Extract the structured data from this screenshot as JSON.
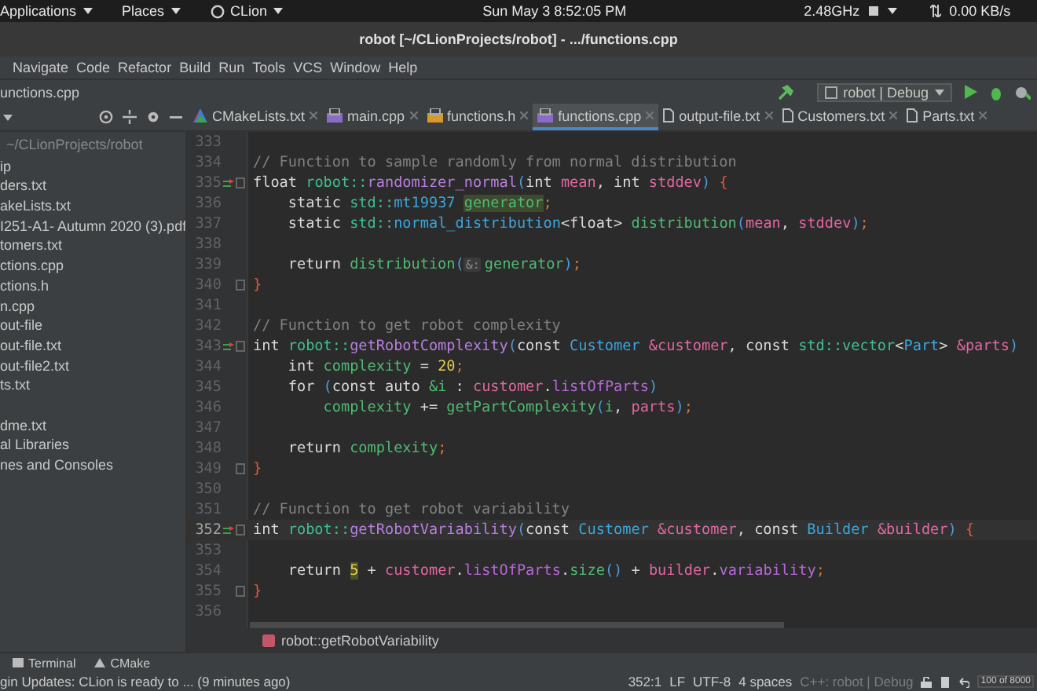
{
  "top_panel": {
    "menus": [
      "Applications",
      "Places",
      "CLion"
    ],
    "clock": "Sun May 3  8:52:05 PM",
    "cpu": "2.48GHz",
    "network": "0.00 KB/s"
  },
  "window": {
    "title": "robot [~/CLionProjects/robot] - .../functions.cpp"
  },
  "menu_bar": [
    "Navigate",
    "Code",
    "Refactor",
    "Build",
    "Run",
    "Tools",
    "VCS",
    "Window",
    "Help"
  ],
  "nav_bar": {
    "path": "unctions.cpp",
    "run_config": "robot | Debug"
  },
  "project_panel": {
    "root": "~/CLionProjects/robot",
    "items": [
      {
        "label": "ip",
        "spaced": false
      },
      {
        "label": "ders.txt",
        "spaced": false
      },
      {
        "label": "akeLists.txt",
        "spaced": false
      },
      {
        "label": "I251-A1- Autumn 2020 (3).pdf",
        "spaced": false
      },
      {
        "label": "tomers.txt",
        "spaced": false
      },
      {
        "label": "ctions.cpp",
        "spaced": false
      },
      {
        "label": "ctions.h",
        "spaced": false
      },
      {
        "label": "n.cpp",
        "spaced": false
      },
      {
        "label": "out-file",
        "spaced": false
      },
      {
        "label": "out-file.txt",
        "spaced": false
      },
      {
        "label": "out-file2.txt",
        "spaced": false
      },
      {
        "label": "ts.txt",
        "spaced": false
      },
      {
        "label": "dme.txt",
        "spaced": true
      },
      {
        "label": "al Libraries",
        "spaced": false
      },
      {
        "label": "nes and Consoles",
        "spaced": false
      }
    ]
  },
  "tabs": [
    {
      "label": "CMakeLists.txt",
      "kind": "cmake",
      "selected": false
    },
    {
      "label": "main.cpp",
      "kind": "cpp",
      "selected": false
    },
    {
      "label": "functions.h",
      "kind": "header",
      "selected": false
    },
    {
      "label": "functions.cpp",
      "kind": "cpp",
      "selected": true
    },
    {
      "label": "output-file.txt",
      "kind": "text",
      "selected": false
    },
    {
      "label": "Customers.txt",
      "kind": "text",
      "selected": false
    },
    {
      "label": "Parts.txt",
      "kind": "text",
      "selected": false
    }
  ],
  "editor": {
    "lines": [
      {
        "number": "333",
        "gutter_icon": false,
        "fold": false,
        "current": false
      },
      {
        "number": "334",
        "gutter_icon": false,
        "fold": false,
        "current": false,
        "tokens": [
          {
            "kind": "comment",
            "text": "// Function to sample randomly from normal distribution"
          }
        ]
      },
      {
        "number": "335",
        "gutter_icon": true,
        "fold": true,
        "current": false,
        "tokens": [
          {
            "kind": "keyword",
            "text": "float "
          },
          {
            "kind": "namespace",
            "text": "robot::"
          },
          {
            "kind": "function",
            "text": "randomizer_normal"
          },
          {
            "kind": "paren",
            "text": "("
          },
          {
            "kind": "keyword",
            "text": "int "
          },
          {
            "kind": "param",
            "text": "mean"
          },
          {
            "kind": "plain",
            "text": ", "
          },
          {
            "kind": "keyword",
            "text": "int "
          },
          {
            "kind": "param",
            "text": "stddev"
          },
          {
            "kind": "paren",
            "text": ")"
          },
          {
            "kind": "brace",
            "text": " {"
          }
        ]
      },
      {
        "number": "336",
        "gutter_icon": false,
        "fold": false,
        "current": false,
        "tokens": [
          {
            "kind": "keyword",
            "text": "    static "
          },
          {
            "kind": "namespace",
            "text": "std::"
          },
          {
            "kind": "class",
            "text": "mt19937 "
          },
          {
            "kind": "variable_highlighted",
            "text": "generator"
          },
          {
            "kind": "semicolon",
            "text": ";"
          }
        ]
      },
      {
        "number": "337",
        "gutter_icon": false,
        "fold": false,
        "current": false,
        "tokens": [
          {
            "kind": "keyword",
            "text": "    static "
          },
          {
            "kind": "namespace",
            "text": "std::"
          },
          {
            "kind": "class",
            "text": "normal_distribution"
          },
          {
            "kind": "plain",
            "text": "<float> "
          },
          {
            "kind": "variable",
            "text": "distribution"
          },
          {
            "kind": "paren",
            "text": "("
          },
          {
            "kind": "param",
            "text": "mean"
          },
          {
            "kind": "plain",
            "text": ", "
          },
          {
            "kind": "param",
            "text": "stddev"
          },
          {
            "kind": "paren",
            "text": ")"
          },
          {
            "kind": "semicolon",
            "text": ";"
          }
        ]
      },
      {
        "number": "338",
        "gutter_icon": false,
        "fold": false,
        "current": false
      },
      {
        "number": "339",
        "gutter_icon": false,
        "fold": false,
        "current": false,
        "tokens": [
          {
            "kind": "keyword",
            "text": "    return "
          },
          {
            "kind": "variable",
            "text": "distribution"
          },
          {
            "kind": "paren",
            "text": "("
          },
          {
            "kind": "hint",
            "text": "&:"
          },
          {
            "kind": "variable",
            "text": "generator"
          },
          {
            "kind": "paren",
            "text": ")"
          },
          {
            "kind": "semicolon",
            "text": ";"
          }
        ]
      },
      {
        "number": "340",
        "gutter_icon": false,
        "fold": true,
        "current": false,
        "tokens": [
          {
            "kind": "brace",
            "text": "}"
          }
        ]
      },
      {
        "number": "341",
        "gutter_icon": false,
        "fold": false,
        "current": false
      },
      {
        "number": "342",
        "gutter_icon": false,
        "fold": false,
        "current": false,
        "tokens": [
          {
            "kind": "comment",
            "text": "// Function to get robot complexity"
          }
        ]
      },
      {
        "number": "343",
        "gutter_icon": true,
        "fold": true,
        "current": false,
        "tokens": [
          {
            "kind": "keyword",
            "text": "int "
          },
          {
            "kind": "namespace",
            "text": "robot::"
          },
          {
            "kind": "function",
            "text": "getRobotComplexity"
          },
          {
            "kind": "paren",
            "text": "("
          },
          {
            "kind": "keyword",
            "text": "const "
          },
          {
            "kind": "class",
            "text": "Customer "
          },
          {
            "kind": "param",
            "text": "&customer"
          },
          {
            "kind": "plain",
            "text": ", const "
          },
          {
            "kind": "namespace",
            "text": "std::vector"
          },
          {
            "kind": "plain",
            "text": "<"
          },
          {
            "kind": "class",
            "text": "Part"
          },
          {
            "kind": "plain",
            "text": "> "
          },
          {
            "kind": "param",
            "text": "&parts"
          },
          {
            "kind": "paren",
            "text": ")"
          }
        ]
      },
      {
        "number": "344",
        "gutter_icon": false,
        "fold": false,
        "current": false,
        "tokens": [
          {
            "kind": "keyword",
            "text": "    int "
          },
          {
            "kind": "variable",
            "text": "complexity"
          },
          {
            "kind": "plain",
            "text": " = "
          },
          {
            "kind": "number",
            "text": "20"
          },
          {
            "kind": "semicolon",
            "text": ";"
          }
        ]
      },
      {
        "number": "345",
        "gutter_icon": false,
        "fold": false,
        "current": false,
        "tokens": [
          {
            "kind": "keyword",
            "text": "    for "
          },
          {
            "kind": "paren",
            "text": "("
          },
          {
            "kind": "keyword",
            "text": "const auto "
          },
          {
            "kind": "variable",
            "text": "&i"
          },
          {
            "kind": "plain",
            "text": " : "
          },
          {
            "kind": "param",
            "text": "customer"
          },
          {
            "kind": "plain",
            "text": "."
          },
          {
            "kind": "field",
            "text": "listOfParts"
          },
          {
            "kind": "paren",
            "text": ")"
          }
        ]
      },
      {
        "number": "346",
        "gutter_icon": false,
        "fold": false,
        "current": false,
        "tokens": [
          {
            "kind": "variable",
            "text": "        complexity"
          },
          {
            "kind": "plain",
            "text": " += "
          },
          {
            "kind": "variable",
            "text": "getPartComplexity"
          },
          {
            "kind": "paren",
            "text": "("
          },
          {
            "kind": "variable",
            "text": "i"
          },
          {
            "kind": "plain",
            "text": ", "
          },
          {
            "kind": "param",
            "text": "parts"
          },
          {
            "kind": "paren",
            "text": ")"
          },
          {
            "kind": "semicolon",
            "text": ";"
          }
        ]
      },
      {
        "number": "347",
        "gutter_icon": false,
        "fold": false,
        "current": false
      },
      {
        "number": "348",
        "gutter_icon": false,
        "fold": false,
        "current": false,
        "tokens": [
          {
            "kind": "keyword",
            "text": "    return "
          },
          {
            "kind": "variable",
            "text": "complexity"
          },
          {
            "kind": "semicolon",
            "text": ";"
          }
        ]
      },
      {
        "number": "349",
        "gutter_icon": false,
        "fold": true,
        "current": false,
        "tokens": [
          {
            "kind": "brace",
            "text": "}"
          }
        ]
      },
      {
        "number": "350",
        "gutter_icon": false,
        "fold": false,
        "current": false
      },
      {
        "number": "351",
        "gutter_icon": false,
        "fold": false,
        "current": false,
        "tokens": [
          {
            "kind": "comment",
            "text": "// Function to get robot variability"
          }
        ]
      },
      {
        "number": "352",
        "gutter_icon": true,
        "fold": true,
        "current": true,
        "tokens": [
          {
            "kind": "keyword",
            "text": "int "
          },
          {
            "kind": "namespace",
            "text": "robot::"
          },
          {
            "kind": "function",
            "text": "getRobotVariability"
          },
          {
            "kind": "paren",
            "text": "("
          },
          {
            "kind": "keyword",
            "text": "const "
          },
          {
            "kind": "class",
            "text": "Customer "
          },
          {
            "kind": "param",
            "text": "&customer"
          },
          {
            "kind": "plain",
            "text": ", const "
          },
          {
            "kind": "class",
            "text": "Builder "
          },
          {
            "kind": "param",
            "text": "&builder"
          },
          {
            "kind": "paren",
            "text": ")"
          },
          {
            "kind": "brace",
            "text": " {"
          }
        ]
      },
      {
        "number": "353",
        "gutter_icon": false,
        "fold": false,
        "current": false
      },
      {
        "number": "354",
        "gutter_icon": false,
        "fold": false,
        "current": false,
        "tokens": [
          {
            "kind": "keyword",
            "text": "    return "
          },
          {
            "kind": "number_highlighted",
            "text": "5"
          },
          {
            "kind": "plain",
            "text": " + "
          },
          {
            "kind": "param",
            "text": "customer"
          },
          {
            "kind": "plain",
            "text": "."
          },
          {
            "kind": "field",
            "text": "listOfParts"
          },
          {
            "kind": "plain",
            "text": "."
          },
          {
            "kind": "variable",
            "text": "size"
          },
          {
            "kind": "paren",
            "text": "()"
          },
          {
            "kind": "plain",
            "text": " + "
          },
          {
            "kind": "param",
            "text": "builder"
          },
          {
            "kind": "plain",
            "text": "."
          },
          {
            "kind": "field",
            "text": "variability"
          },
          {
            "kind": "semicolon",
            "text": ";"
          }
        ]
      },
      {
        "number": "355",
        "gutter_icon": false,
        "fold": true,
        "current": false,
        "tokens": [
          {
            "kind": "brace",
            "text": "}"
          }
        ]
      },
      {
        "number": "356",
        "gutter_icon": false,
        "fold": false,
        "current": false
      }
    ],
    "breadcrumb": "robot::getRobotVariability"
  },
  "tool_tabs": [
    "Terminal",
    "CMake"
  ],
  "status_bar": {
    "message": "gin Updates: CLion is ready to ... (9 minutes ago)",
    "items": [
      "352:1",
      "LF",
      "UTF-8",
      "4 spaces"
    ],
    "context": "C++: robot | Debug",
    "memory": "100 of 8000"
  }
}
